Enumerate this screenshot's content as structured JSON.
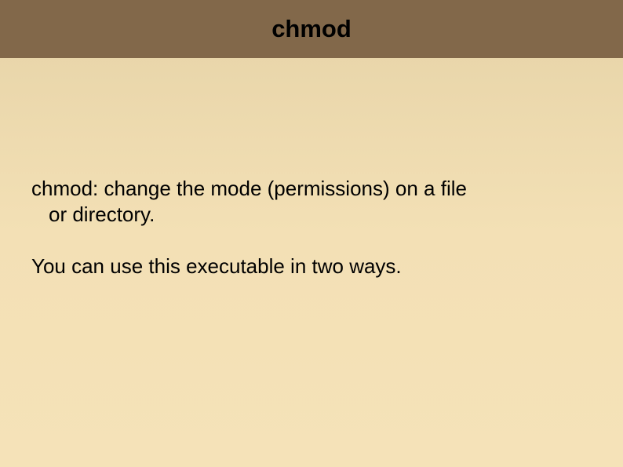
{
  "slide": {
    "title": "chmod",
    "line1a": "chmod: change the mode (permissions) on a file",
    "line1b": "or directory.",
    "line2": "You can use this executable in two ways."
  }
}
